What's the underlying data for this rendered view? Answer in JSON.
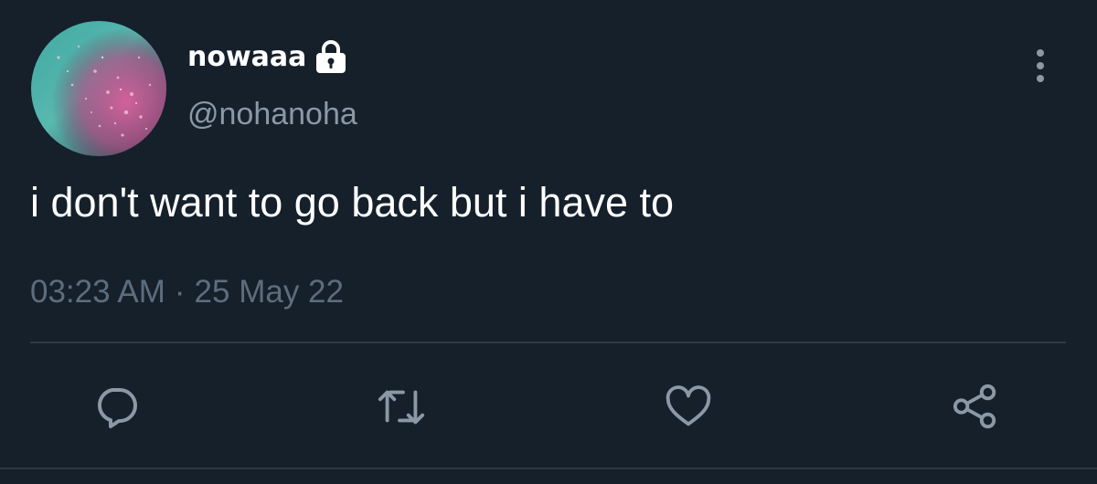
{
  "user": {
    "display_name": "nowaaa",
    "handle": "@nohanoha",
    "protected_icon": "lock-icon"
  },
  "tweet": {
    "text": "i don't want to go back but i have to",
    "time": "03:23 AM",
    "separator": "·",
    "date": "25 May 22"
  },
  "actions": {
    "reply_icon": "reply-icon",
    "retweet_icon": "retweet-icon",
    "like_icon": "heart-icon",
    "share_icon": "share-icon"
  },
  "colors": {
    "background": "#15202b",
    "primary_text": "#ffffff",
    "secondary_text": "#8b98a5",
    "icon": "#8b98a5",
    "divider": "#2c3944"
  }
}
